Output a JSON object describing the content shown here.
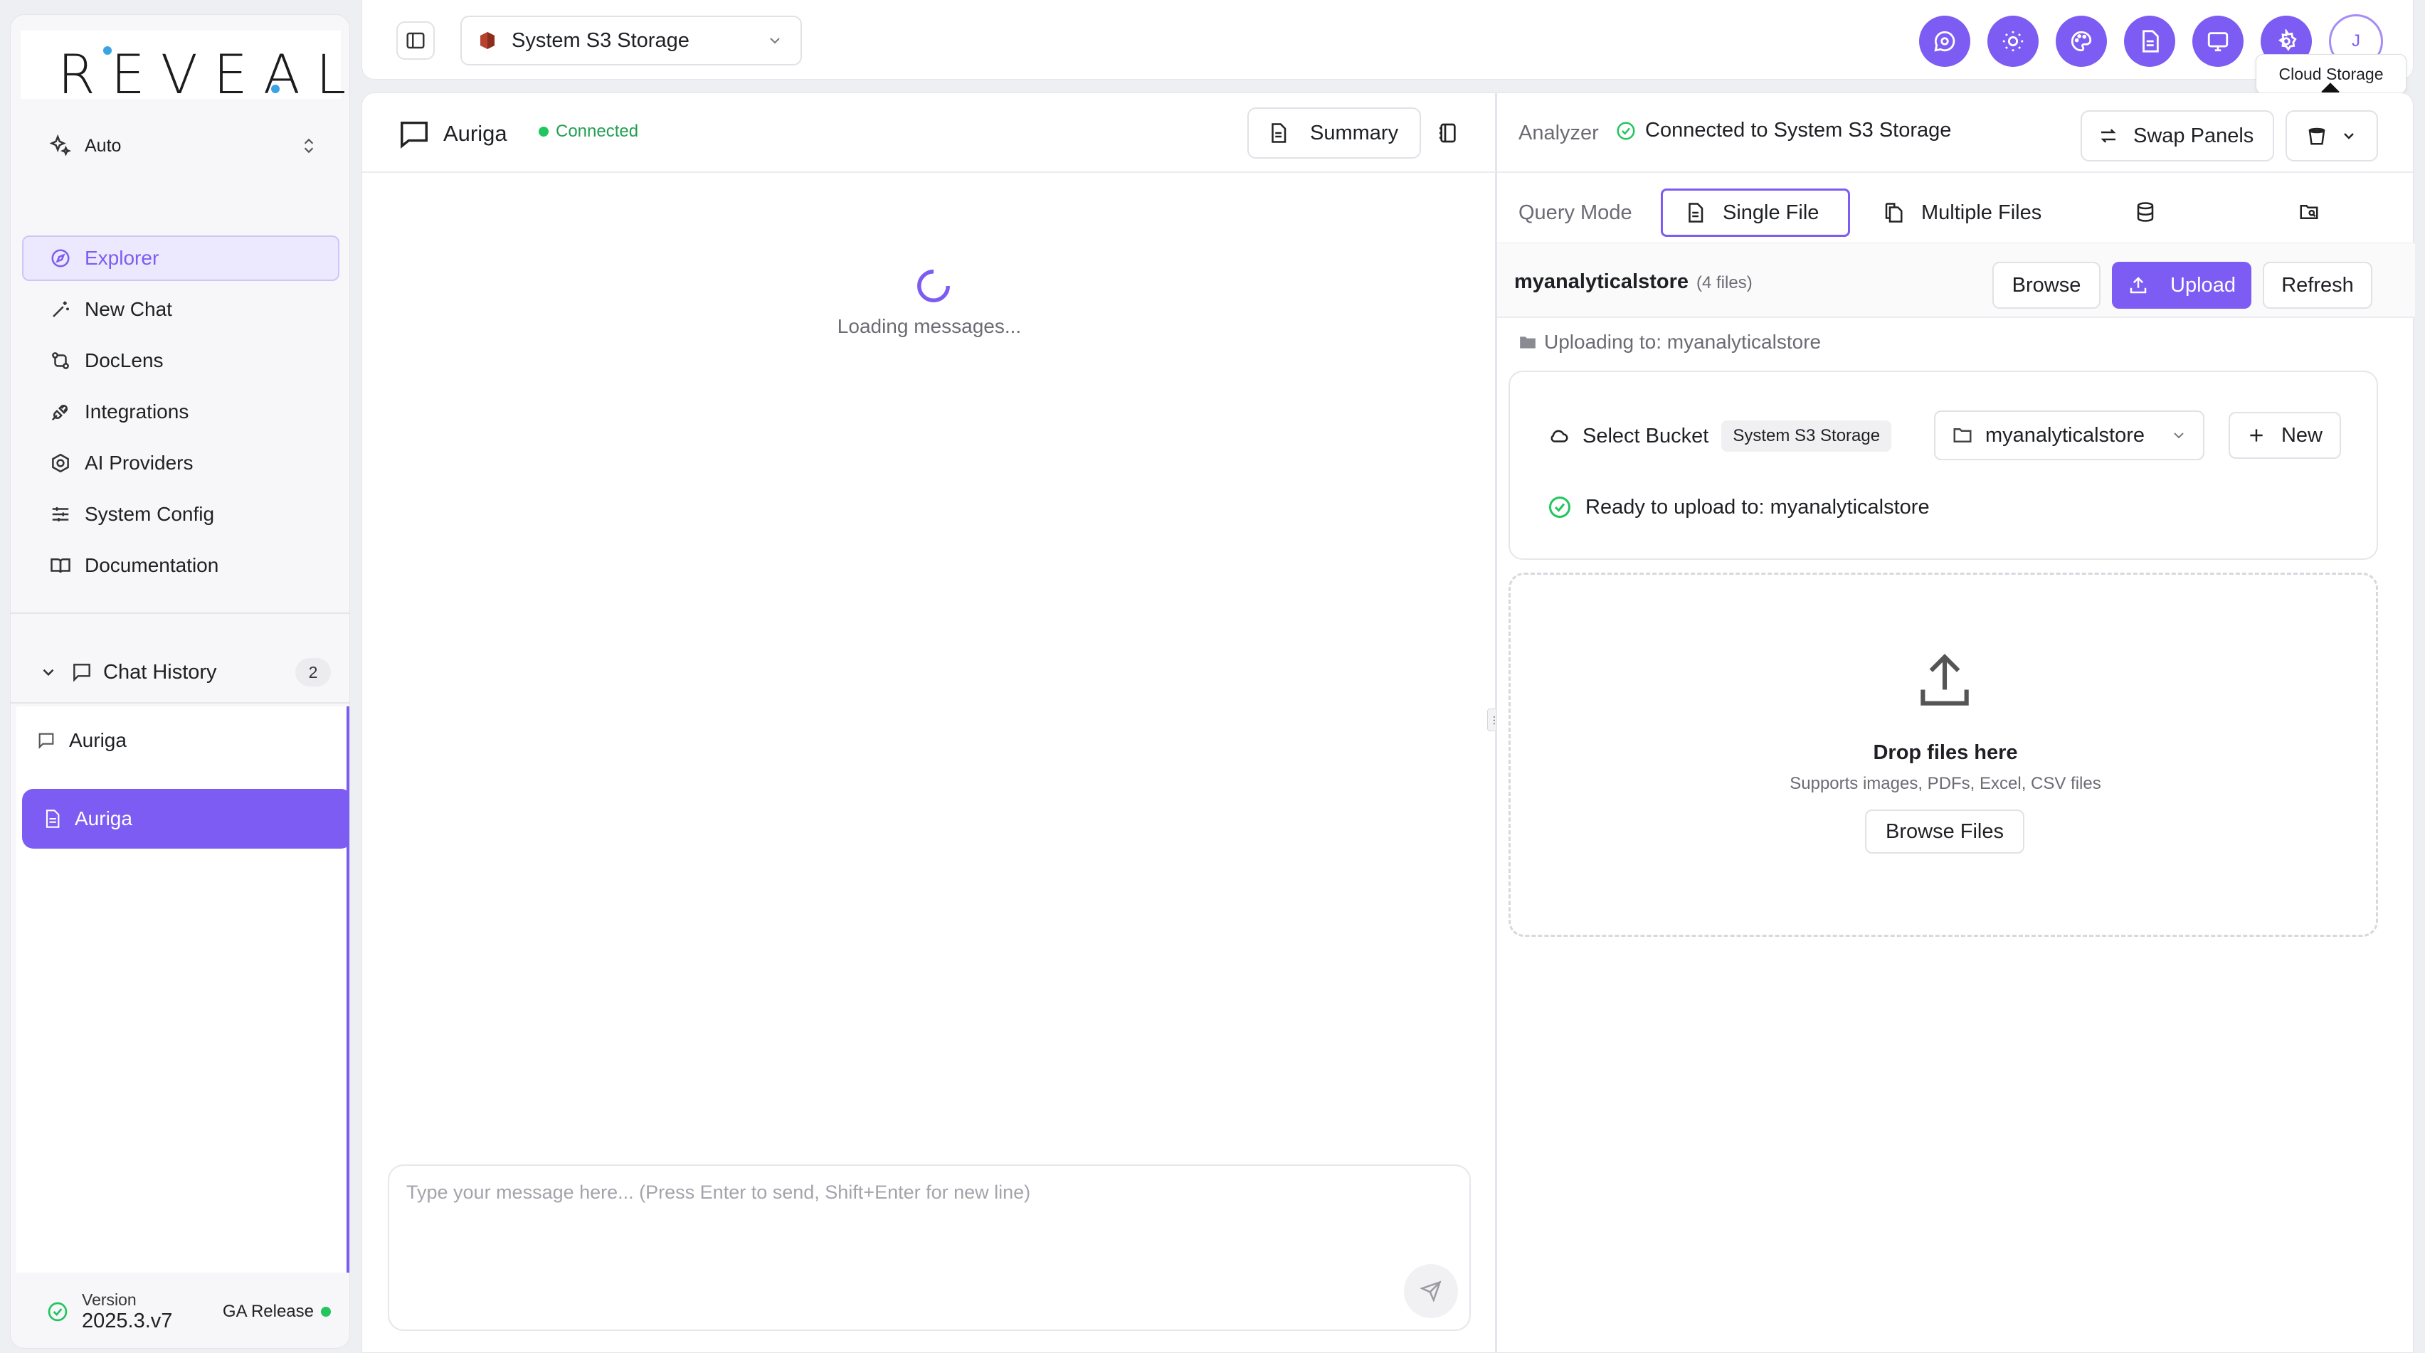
{
  "sidebar": {
    "logo": "REVEAL",
    "mode": "Auto",
    "nav": [
      {
        "label": "Explorer",
        "icon": "compass-icon",
        "active": true
      },
      {
        "label": "New Chat",
        "icon": "magic-wand-icon"
      },
      {
        "label": "DocLens",
        "icon": "git-compare-icon"
      },
      {
        "label": "Integrations",
        "icon": "plug-icon"
      },
      {
        "label": "AI Providers",
        "icon": "hexagon-icon"
      },
      {
        "label": "System Config",
        "icon": "sliders-icon"
      },
      {
        "label": "Documentation",
        "icon": "book-icon"
      }
    ],
    "history": {
      "title": "Chat History",
      "count": "2",
      "items": [
        {
          "label": "Auriga",
          "icon": "message-icon",
          "active": false
        },
        {
          "label": "Auriga",
          "icon": "document-icon",
          "active": true
        }
      ]
    },
    "version": {
      "label": "Version",
      "number": "2025.3.v7",
      "release": "GA Release"
    }
  },
  "topbar": {
    "storage": "System S3 Storage",
    "icons": [
      "message-circle-icon",
      "sun-icon",
      "palette-icon",
      "file-text-icon",
      "monitor-message-icon",
      "gear-icon"
    ],
    "avatar": "J",
    "tooltip": "Cloud Storage"
  },
  "chat": {
    "title": "Auriga",
    "status": "Connected",
    "summary_label": "Summary",
    "loading": "Loading messages...",
    "placeholder": "Type your message here... (Press Enter to send, Shift+Enter for new line)"
  },
  "analyzer": {
    "label": "Analyzer",
    "connection": "Connected to System S3 Storage",
    "swap_label": "Swap Panels",
    "query_mode_label": "Query Mode",
    "tabs": {
      "single": "Single File",
      "multiple": "Multiple Files"
    },
    "store": {
      "name": "myanalyticalstore",
      "count": "(4 files)"
    },
    "buttons": {
      "browse": "Browse",
      "upload": "Upload",
      "refresh": "Refresh"
    },
    "uploading_to": "Uploading to: myanalyticalstore",
    "bucket": {
      "select_label": "Select Bucket",
      "pill": "System S3 Storage",
      "selected": "myanalyticalstore",
      "new_label": "New",
      "ready": "Ready to upload to: myanalyticalstore"
    },
    "drop": {
      "title": "Drop files here",
      "subtitle": "Supports images, PDFs, Excel, CSV files",
      "browse_label": "Browse Files"
    }
  },
  "colors": {
    "accent": "#7c5cf2",
    "success": "#22c55e"
  }
}
